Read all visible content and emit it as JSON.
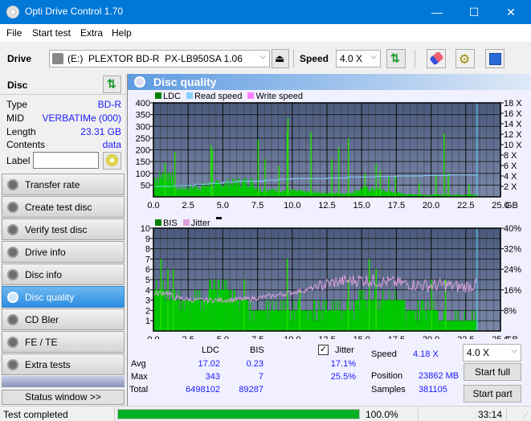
{
  "window": {
    "title": "Opti Drive Control 1.70",
    "minimize": "—",
    "maximize": "☐",
    "close": "✕"
  },
  "menu": [
    "File",
    "Start test",
    "Extra",
    "Help"
  ],
  "toolbar": {
    "drive_label": "Drive",
    "drive_value": "(E:)  PLEXTOR BD-R  PX-LB950SA 1.06",
    "speed_label": "Speed",
    "speed_value": "4.0 X"
  },
  "disc": {
    "header": "Disc",
    "fields": [
      {
        "key": "Type",
        "value": "BD-R"
      },
      {
        "key": "MID",
        "value": "VERBATIMe (000)"
      },
      {
        "key": "Length",
        "value": "23.31 GB"
      },
      {
        "key": "Contents",
        "value": "data"
      }
    ],
    "label_key": "Label",
    "label_value": ""
  },
  "nav": [
    {
      "label": "Transfer rate",
      "active": false
    },
    {
      "label": "Create test disc",
      "active": false
    },
    {
      "label": "Verify test disc",
      "active": false
    },
    {
      "label": "Drive info",
      "active": false
    },
    {
      "label": "Disc info",
      "active": false
    },
    {
      "label": "Disc quality",
      "active": true
    },
    {
      "label": "CD Bler",
      "active": false
    },
    {
      "label": "FE / TE",
      "active": false
    },
    {
      "label": "Extra tests",
      "active": false
    }
  ],
  "status_window_button": "Status window >>",
  "panel_title": "Disc quality",
  "chart_data": [
    {
      "type": "bar",
      "title": "LDC / Read speed",
      "legend": [
        {
          "name": "LDC",
          "color": "#008000"
        },
        {
          "name": "Read speed",
          "color": "#87cefa"
        },
        {
          "name": "Write speed",
          "color": "#ff80ff"
        }
      ],
      "xlabel": "GB",
      "xlim": [
        0,
        25
      ],
      "x_ticks": [
        "0.0",
        "2.5",
        "5.0",
        "7.5",
        "10.0",
        "12.5",
        "15.0",
        "17.5",
        "20.0",
        "22.5",
        "25.0"
      ],
      "ylim": [
        0,
        400
      ],
      "y_ticks": [
        "50",
        "100",
        "150",
        "200",
        "250",
        "300",
        "350",
        "400"
      ],
      "y2lim": [
        0,
        18
      ],
      "y2_ticks": [
        "2 X",
        "4 X",
        "6 X",
        "8 X",
        "10 X",
        "12 X",
        "14 X",
        "16 X",
        "18 X"
      ],
      "data_end_gb": 23.31,
      "ldc_baseline": [
        [
          0,
          80
        ],
        [
          1,
          90
        ],
        [
          1.2,
          110
        ],
        [
          1.5,
          35
        ],
        [
          3,
          40
        ],
        [
          5,
          55
        ],
        [
          7,
          65
        ],
        [
          7.5,
          30
        ],
        [
          10,
          25
        ],
        [
          11,
          20
        ],
        [
          13,
          15
        ],
        [
          14,
          15
        ],
        [
          15,
          35
        ],
        [
          16,
          30
        ],
        [
          17,
          20
        ],
        [
          18,
          12
        ],
        [
          20,
          8
        ],
        [
          22,
          10
        ],
        [
          23.3,
          8
        ]
      ],
      "ldc_spikes": [
        [
          0.8,
          145
        ],
        [
          1.5,
          190
        ],
        [
          4.1,
          220
        ],
        [
          4.2,
          200
        ],
        [
          7.5,
          245
        ],
        [
          8.0,
          160
        ],
        [
          9.0,
          130
        ],
        [
          9.6,
          280
        ],
        [
          9.65,
          335
        ],
        [
          11.3,
          275
        ],
        [
          12.8,
          160
        ],
        [
          13.3,
          210
        ],
        [
          14.0,
          250
        ],
        [
          15.2,
          100
        ],
        [
          16.0,
          140
        ],
        [
          16.3,
          110
        ],
        [
          16.9,
          85
        ],
        [
          17.4,
          85
        ],
        [
          19.1,
          60
        ],
        [
          20.3,
          95
        ],
        [
          20.9,
          270
        ],
        [
          21.2,
          100
        ],
        [
          22.7,
          55
        ]
      ],
      "read_speed": [
        [
          0,
          2.0
        ],
        [
          1.5,
          2.2
        ],
        [
          3,
          2.4
        ],
        [
          4,
          2.6
        ],
        [
          5,
          2.8
        ],
        [
          6,
          3.0
        ],
        [
          8,
          3.2
        ],
        [
          9,
          3.4
        ],
        [
          10,
          3.5
        ],
        [
          12.5,
          3.6
        ],
        [
          14,
          3.8
        ],
        [
          16,
          3.9
        ],
        [
          17.5,
          4.0
        ],
        [
          19.5,
          4.1
        ],
        [
          21.3,
          4.2
        ],
        [
          23.31,
          4.2
        ]
      ]
    },
    {
      "type": "bar",
      "title": "BIS / Jitter",
      "legend": [
        {
          "name": "BIS",
          "color": "#008000"
        },
        {
          "name": "Jitter",
          "color": "#dda0dd"
        }
      ],
      "xlabel": "GB",
      "xlim": [
        0,
        25
      ],
      "x_ticks": [
        "0.0",
        "2.5",
        "5.0",
        "7.5",
        "10.0",
        "12.5",
        "15.0",
        "17.5",
        "20.0",
        "22.5",
        "25.0"
      ],
      "ylim": [
        0,
        10
      ],
      "y_ticks": [
        "1",
        "2",
        "3",
        "4",
        "5",
        "6",
        "7",
        "8",
        "9",
        "10"
      ],
      "y2lim": [
        0,
        40
      ],
      "y2_ticks": [
        "8%",
        "16%",
        "24%",
        "32%",
        "40%"
      ],
      "data_end_gb": 23.31,
      "bis_baseline": [
        [
          0,
          4
        ],
        [
          1.5,
          3
        ],
        [
          3,
          3
        ],
        [
          5,
          4
        ],
        [
          7.5,
          2
        ],
        [
          10,
          2
        ],
        [
          12,
          2
        ],
        [
          14,
          2
        ],
        [
          15,
          3
        ],
        [
          17,
          3
        ],
        [
          19,
          2
        ],
        [
          22,
          1
        ],
        [
          23.31,
          1
        ]
      ],
      "bis_spikes": [
        [
          0.5,
          7
        ],
        [
          1.0,
          6
        ],
        [
          1.4,
          6
        ],
        [
          6.5,
          5
        ],
        [
          9.6,
          7
        ],
        [
          10.5,
          4
        ],
        [
          14.0,
          5
        ],
        [
          15.5,
          7
        ],
        [
          16.0,
          6
        ],
        [
          20.0,
          5
        ],
        [
          21.0,
          5
        ]
      ],
      "jitter_pct": [
        [
          0,
          14.5
        ],
        [
          1,
          15
        ],
        [
          1.5,
          13
        ],
        [
          3,
          12
        ],
        [
          5,
          12
        ],
        [
          7,
          12.5
        ],
        [
          9,
          14
        ],
        [
          10,
          15
        ],
        [
          11,
          16
        ],
        [
          12,
          17.5
        ],
        [
          13,
          19
        ],
        [
          15,
          20
        ],
        [
          17,
          19
        ],
        [
          19,
          18
        ],
        [
          20,
          17.5
        ],
        [
          21,
          18
        ],
        [
          22,
          17
        ],
        [
          23.31,
          18
        ]
      ]
    }
  ],
  "stats": {
    "col_ldc": "LDC",
    "col_bis": "BIS",
    "jitter_checked": true,
    "jitter_label": "Jitter",
    "rows": [
      {
        "label": "Avg",
        "ldc": "17.02",
        "bis": "0.23",
        "jitter": "17.1%"
      },
      {
        "label": "Max",
        "ldc": "343",
        "bis": "7",
        "jitter": "25.5%"
      },
      {
        "label": "Total",
        "ldc": "6498102",
        "bis": "89287",
        "jitter": ""
      }
    ],
    "speed_label": "Speed",
    "speed_value": "4.18 X",
    "position_label": "Position",
    "position_value": "23862 MB",
    "samples_label": "Samples",
    "samples_value": "381105",
    "speed_select": "4.0 X",
    "start_full": "Start full",
    "start_part": "Start part"
  },
  "status": {
    "text": "Test completed",
    "progress": 1.0,
    "percent": "100.0%",
    "elapsed": "33:14"
  }
}
